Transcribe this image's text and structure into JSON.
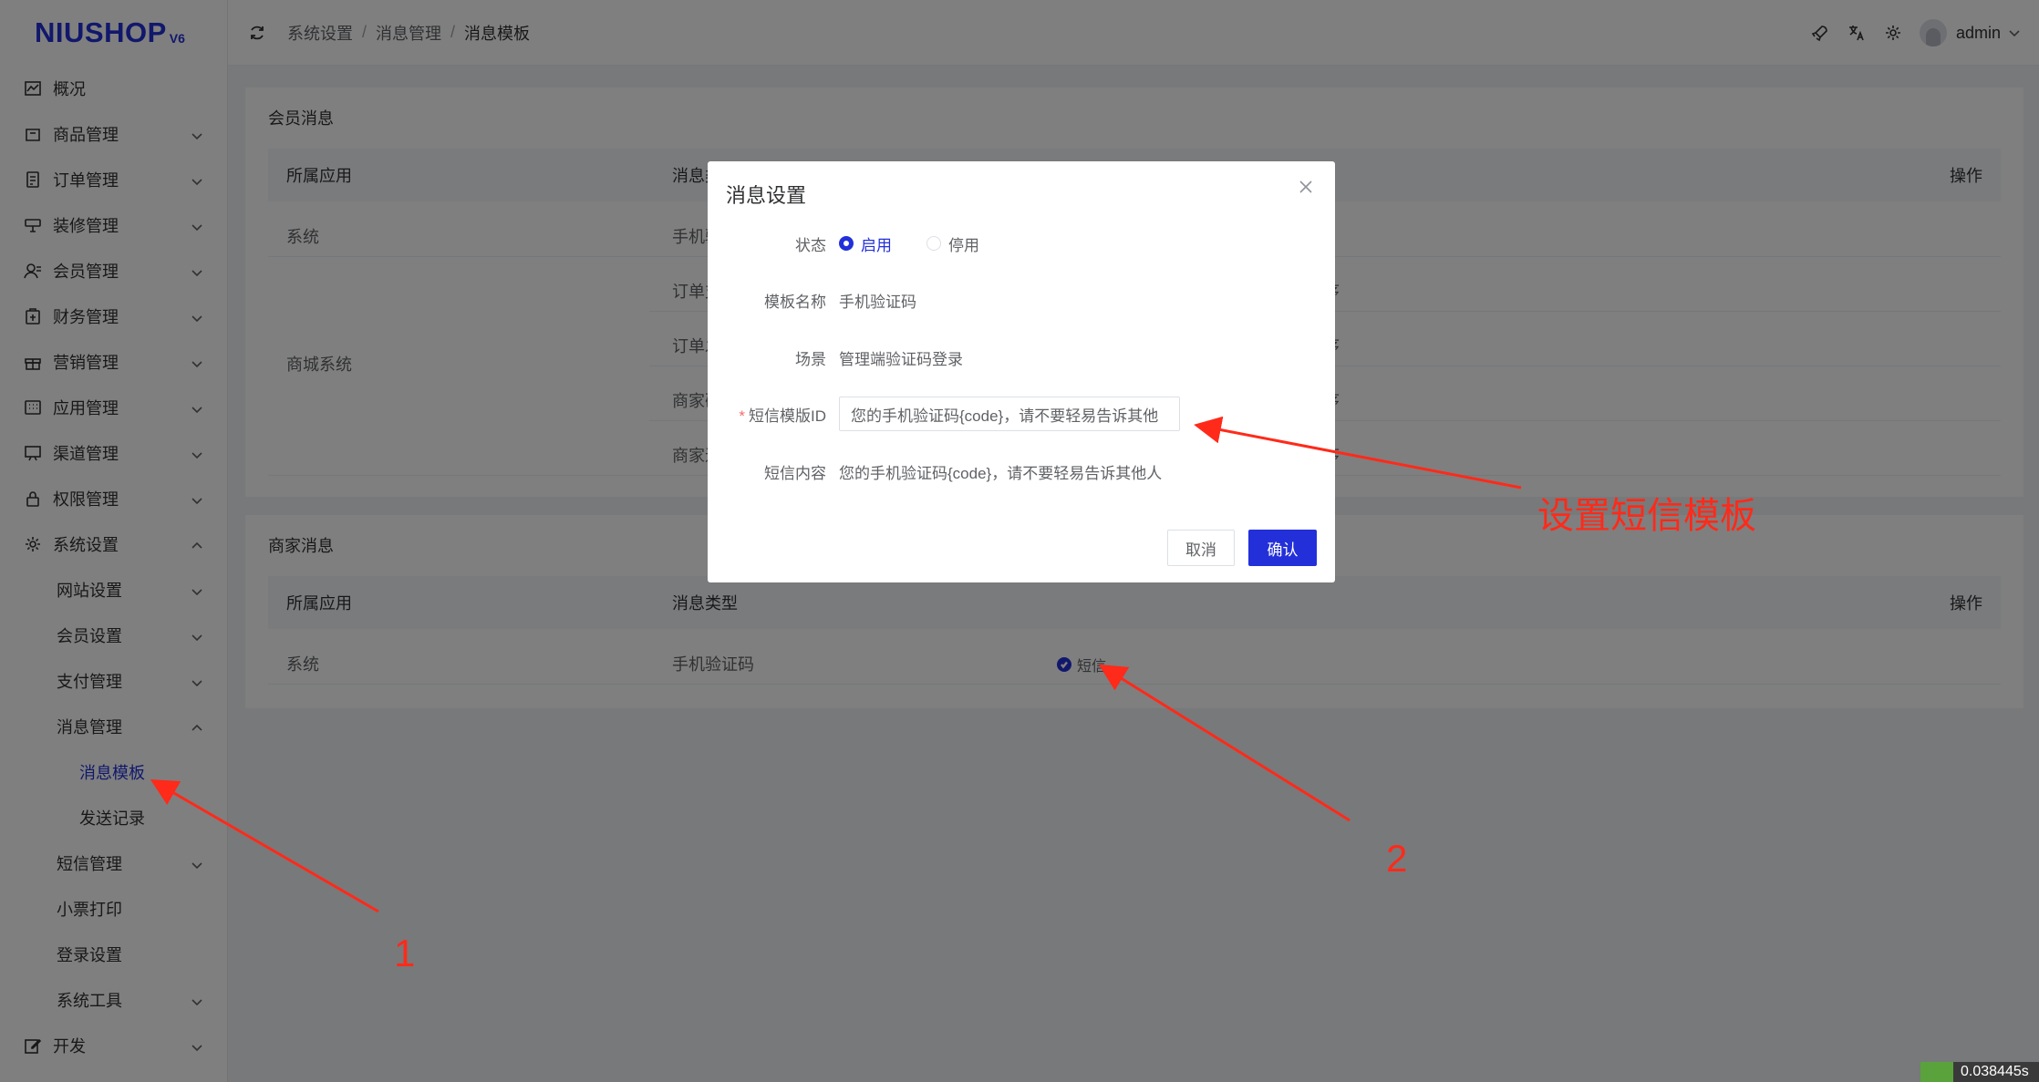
{
  "app": {
    "logo": "NIUSHOP",
    "logo_version": "V6"
  },
  "sidebar": {
    "items": [
      {
        "label": "概况",
        "icon": "chart-icon"
      },
      {
        "label": "商品管理",
        "icon": "goods-icon"
      },
      {
        "label": "订单管理",
        "icon": "order-icon"
      },
      {
        "label": "装修管理",
        "icon": "decorate-icon"
      },
      {
        "label": "会员管理",
        "icon": "member-icon"
      },
      {
        "label": "财务管理",
        "icon": "finance-icon"
      },
      {
        "label": "营销管理",
        "icon": "gift-icon"
      },
      {
        "label": "应用管理",
        "icon": "app-icon"
      },
      {
        "label": "渠道管理",
        "icon": "channel-icon"
      },
      {
        "label": "权限管理",
        "icon": "lock-icon"
      },
      {
        "label": "系统设置",
        "icon": "gear-icon"
      }
    ],
    "system_sub": [
      {
        "label": "网站设置"
      },
      {
        "label": "会员设置"
      },
      {
        "label": "支付管理"
      },
      {
        "label": "消息管理"
      }
    ],
    "message_sub": [
      {
        "label": "消息模板"
      },
      {
        "label": "发送记录"
      }
    ],
    "system_sub2": [
      {
        "label": "短信管理"
      },
      {
        "label": "小票打印"
      },
      {
        "label": "登录设置"
      },
      {
        "label": "系统工具"
      }
    ],
    "dev": {
      "label": "开发",
      "icon": "edit-icon"
    }
  },
  "header": {
    "breadcrumb": [
      "系统设置",
      "消息管理",
      "消息模板"
    ],
    "username": "admin"
  },
  "member_section": {
    "title": "会员消息",
    "columns": {
      "app": "所属应用",
      "type": "消息类型",
      "action": "操作"
    },
    "rows": [
      {
        "app": "系统",
        "type": "手机验证码"
      },
      {
        "app": "商城系统",
        "type": "订单支付成功",
        "channel_tail": "序"
      },
      {
        "type": "订单发货",
        "channel_tail": "序"
      },
      {
        "type": "商家确认收货",
        "channel_tail": "序"
      },
      {
        "type": "商家退款",
        "channel_tail": "序"
      }
    ]
  },
  "merchant_section": {
    "title": "商家消息",
    "columns": {
      "app": "所属应用",
      "type": "消息类型",
      "action": "操作"
    },
    "rows": [
      {
        "app": "系统",
        "type": "手机验证码",
        "channel": "短信"
      }
    ]
  },
  "dialog": {
    "title": "消息设置",
    "status_label": "状态",
    "status_on": "启用",
    "status_off": "停用",
    "name_label": "模板名称",
    "name_value": "手机验证码",
    "scene_label": "场景",
    "scene_value": "管理端验证码登录",
    "template_id_label": "短信模版ID",
    "template_id_value": "您的手机验证码{code}，请不要轻易告诉其他",
    "content_label": "短信内容",
    "content_value": "您的手机验证码{code}，请不要轻易告诉其他人",
    "cancel": "取消",
    "confirm": "确认"
  },
  "annotations": {
    "callout": "设置短信模板",
    "step1": "1",
    "step2": "2"
  },
  "corner_badge": {
    "text": "0.038445s"
  },
  "colors": {
    "primary": "#2330d9",
    "annotation": "#ff2a1a"
  }
}
